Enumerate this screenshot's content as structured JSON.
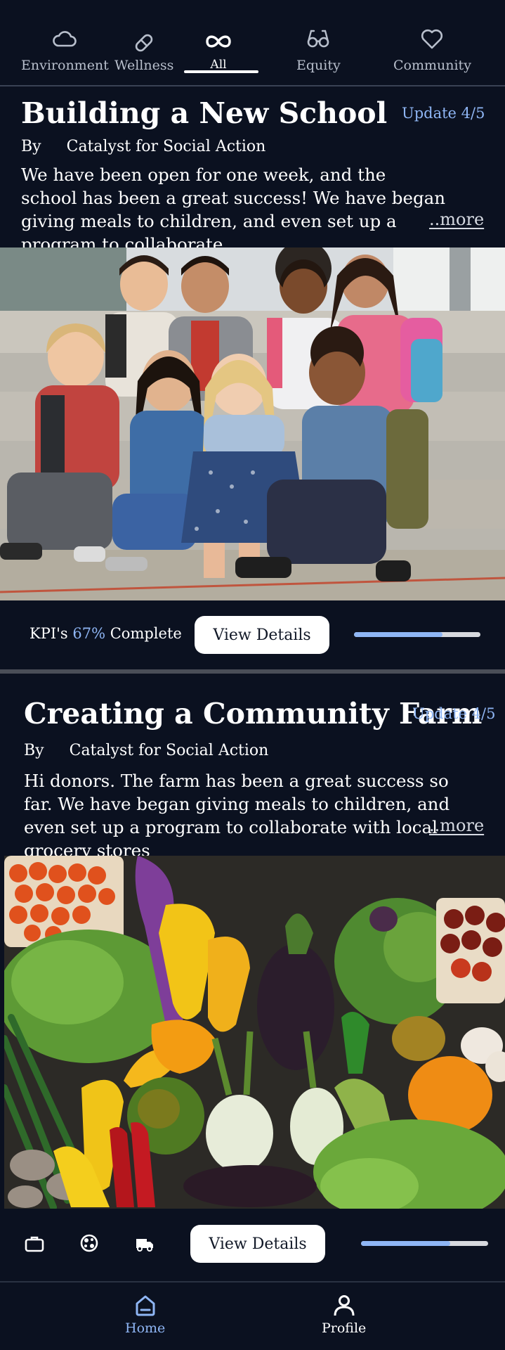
{
  "categories": [
    {
      "label": "Environment",
      "icon": "cloud-icon"
    },
    {
      "label": "Wellness",
      "icon": "pill-icon"
    },
    {
      "label": "All",
      "icon": "infinity-icon"
    },
    {
      "label": "Equity",
      "icon": "glasses-icon"
    },
    {
      "label": "Community",
      "icon": "heart-icon"
    }
  ],
  "active_category": "All",
  "posts": [
    {
      "title": "Building a New School",
      "update": "Update 4/5",
      "by_label": "By",
      "org": "Catalyst for Social Action",
      "body": "We have been open for one week, and the school has been a great success! We have began giving meals to children, and even set up a program to collaborate",
      "more": "..more",
      "kpi_prefix": "KPI's",
      "kpi_percent": "67%",
      "kpi_suffix": "Complete",
      "button": "View Details",
      "progress": 0.7
    },
    {
      "title": "Creating a Community Farm",
      "update": "Update 4/5",
      "by_label": "By",
      "org": "Catalyst for Social Action",
      "body": "Hi donors. The farm has been a great success so far. We have began giving meals to children, and even set up a program to collaborate with local grocery stores",
      "more": "..more",
      "button": "View Details",
      "progress": 0.7,
      "action_icons": [
        "briefcase-icon",
        "globe-icon",
        "truck-icon"
      ]
    }
  ],
  "tabs": [
    {
      "label": "Home",
      "icon": "home-icon",
      "active": true
    },
    {
      "label": "Profile",
      "icon": "profile-icon",
      "active": false
    }
  ],
  "colors": {
    "background": "#0b1120",
    "accent": "#8fb6f5",
    "text": "#ffffff",
    "track": "#d7d9de"
  }
}
